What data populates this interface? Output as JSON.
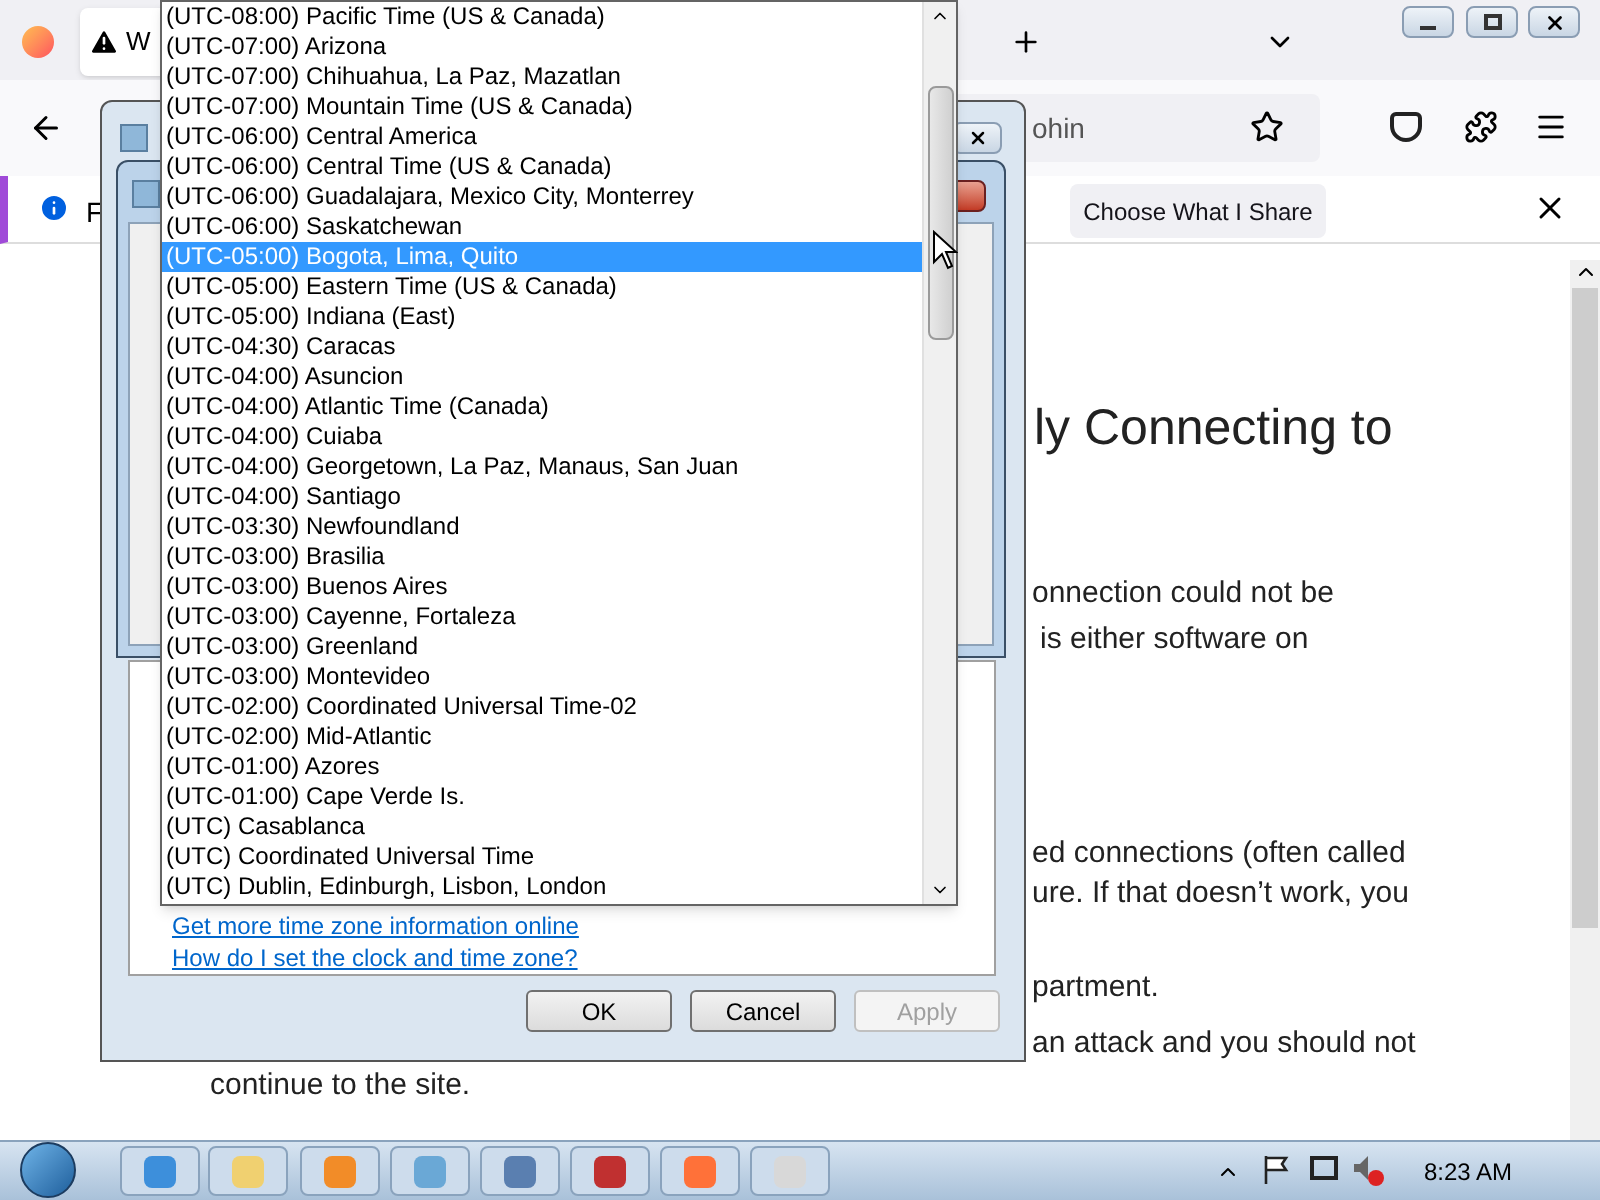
{
  "browser": {
    "tab": {
      "title": "W"
    },
    "address": {
      "value": "ohin"
    },
    "notification": {
      "text": "F",
      "button": "Choose What I Share"
    }
  },
  "page": {
    "heading": "ly Connecting to",
    "lines": [
      "onnection could not be",
      "is either software on",
      "ed connections (often called",
      "ure. If that doesn’t work, you",
      "partment.",
      "an attack and you should not",
      "continue to the site."
    ]
  },
  "dialog": {
    "links": [
      "Get more time zone information online",
      "How do I set the clock and time zone?"
    ],
    "buttons": [
      {
        "label": "OK",
        "disabled": false
      },
      {
        "label": "Cancel",
        "disabled": false
      },
      {
        "label": "Apply",
        "disabled": true
      }
    ]
  },
  "timezone_list": {
    "items": [
      {
        "label": "(UTC-08:00) Pacific Time (US & Canada)",
        "selected": false
      },
      {
        "label": "(UTC-07:00) Arizona",
        "selected": false
      },
      {
        "label": "(UTC-07:00) Chihuahua, La Paz, Mazatlan",
        "selected": false
      },
      {
        "label": "(UTC-07:00) Mountain Time (US & Canada)",
        "selected": false
      },
      {
        "label": "(UTC-06:00) Central America",
        "selected": false
      },
      {
        "label": "(UTC-06:00) Central Time (US & Canada)",
        "selected": false
      },
      {
        "label": "(UTC-06:00) Guadalajara, Mexico City, Monterrey",
        "selected": false
      },
      {
        "label": "(UTC-06:00) Saskatchewan",
        "selected": false
      },
      {
        "label": "(UTC-05:00) Bogota, Lima, Quito",
        "selected": true
      },
      {
        "label": "(UTC-05:00) Eastern Time (US & Canada)",
        "selected": false
      },
      {
        "label": "(UTC-05:00) Indiana (East)",
        "selected": false
      },
      {
        "label": "(UTC-04:30) Caracas",
        "selected": false
      },
      {
        "label": "(UTC-04:00) Asuncion",
        "selected": false
      },
      {
        "label": "(UTC-04:00) Atlantic Time (Canada)",
        "selected": false
      },
      {
        "label": "(UTC-04:00) Cuiaba",
        "selected": false
      },
      {
        "label": "(UTC-04:00) Georgetown, La Paz, Manaus, San Juan",
        "selected": false
      },
      {
        "label": "(UTC-04:00) Santiago",
        "selected": false
      },
      {
        "label": "(UTC-03:30) Newfoundland",
        "selected": false
      },
      {
        "label": "(UTC-03:00) Brasilia",
        "selected": false
      },
      {
        "label": "(UTC-03:00) Buenos Aires",
        "selected": false
      },
      {
        "label": "(UTC-03:00) Cayenne, Fortaleza",
        "selected": false
      },
      {
        "label": "(UTC-03:00) Greenland",
        "selected": false
      },
      {
        "label": "(UTC-03:00) Montevideo",
        "selected": false
      },
      {
        "label": "(UTC-02:00) Coordinated Universal Time-02",
        "selected": false
      },
      {
        "label": "(UTC-02:00) Mid-Atlantic",
        "selected": false
      },
      {
        "label": "(UTC-01:00) Azores",
        "selected": false
      },
      {
        "label": "(UTC-01:00) Cape Verde Is.",
        "selected": false
      },
      {
        "label": "(UTC) Casablanca",
        "selected": false
      },
      {
        "label": "(UTC) Coordinated Universal Time",
        "selected": false
      },
      {
        "label": "(UTC) Dublin, Edinburgh, Lisbon, London",
        "selected": false
      }
    ]
  },
  "taskbar": {
    "clock": "8:23 AM"
  }
}
